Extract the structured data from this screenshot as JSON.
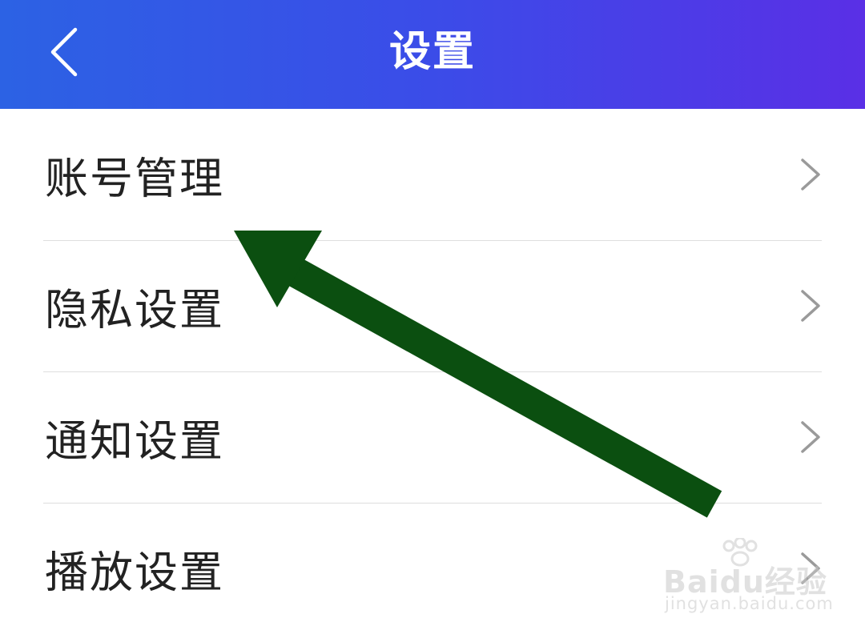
{
  "header": {
    "title": "设置",
    "back_icon": "chevron-left-icon",
    "gradient_start": "#2c62e4",
    "gradient_end": "#5a2fe6"
  },
  "settings": {
    "items": [
      {
        "label": "账号管理",
        "icon": "chevron-right-icon"
      },
      {
        "label": "隐私设置",
        "icon": "chevron-right-icon"
      },
      {
        "label": "通知设置",
        "icon": "chevron-right-icon"
      },
      {
        "label": "播放设置",
        "icon": "chevron-right-icon"
      }
    ]
  },
  "annotation": {
    "icon": "arrow-pointer",
    "color": "#0b4f10"
  },
  "watermark": {
    "main": "Baidu经验",
    "sub": "jingyan.baidu.com"
  }
}
